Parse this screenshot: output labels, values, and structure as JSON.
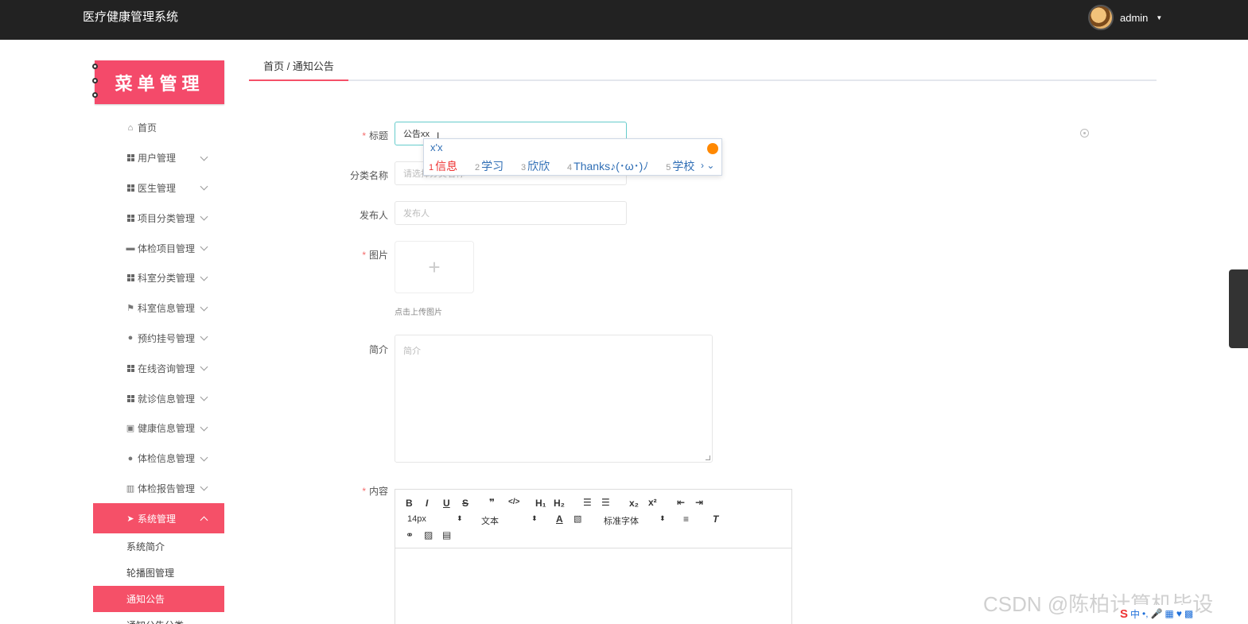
{
  "app": {
    "title": "医疗健康管理系统",
    "user": "admin"
  },
  "sidebar": {
    "banner": "菜单管理",
    "items": [
      {
        "label": "首页",
        "icon": "home-icon"
      },
      {
        "label": "用户管理",
        "icon": "grid-icon"
      },
      {
        "label": "医生管理",
        "icon": "grid-icon"
      },
      {
        "label": "项目分类管理",
        "icon": "grid-icon"
      },
      {
        "label": "体检项目管理",
        "icon": "briefcase-icon"
      },
      {
        "label": "科室分类管理",
        "icon": "grid-icon"
      },
      {
        "label": "科室信息管理",
        "icon": "flag-icon"
      },
      {
        "label": "预约挂号管理",
        "icon": "user-icon"
      },
      {
        "label": "在线咨询管理",
        "icon": "grid-icon"
      },
      {
        "label": "就诊信息管理",
        "icon": "grid-icon"
      },
      {
        "label": "健康信息管理",
        "icon": "clipboard-icon"
      },
      {
        "label": "体检信息管理",
        "icon": "bulb-icon"
      },
      {
        "label": "体检报告管理",
        "icon": "book-icon"
      },
      {
        "label": "系统管理",
        "icon": "send-icon"
      }
    ],
    "subitems": [
      "系统简介",
      "轮播图管理",
      "通知公告",
      "通知公告分类"
    ]
  },
  "breadcrumb": "首页 / 通知公告",
  "form": {
    "title_label": "标题",
    "title_value": "公告xx",
    "category_label": "分类名称",
    "category_placeholder": "请选择分类名称",
    "publisher_label": "发布人",
    "publisher_placeholder": "发布人",
    "image_label": "图片",
    "upload_hint": "点击上传图片",
    "intro_label": "简介",
    "intro_placeholder": "简介",
    "content_label": "内容"
  },
  "editor": {
    "font_size": "14px",
    "format": "文本",
    "font_family": "标准字体"
  },
  "ime": {
    "composition": "x'x",
    "candidates": [
      {
        "num": "1",
        "text": "信息"
      },
      {
        "num": "2",
        "text": "学习"
      },
      {
        "num": "3",
        "text": "欣欣"
      },
      {
        "num": "4",
        "text": "Thanks♪(･ω･)ﾉ"
      },
      {
        "num": "5",
        "text": "学校"
      }
    ],
    "nav": "› ⌄"
  },
  "watermark": "CSDN @陈柏计算机毕设",
  "tray": {
    "s": "S",
    "mode": "中"
  },
  "colors": {
    "accent": "#f55068",
    "topbar": "#222222"
  }
}
